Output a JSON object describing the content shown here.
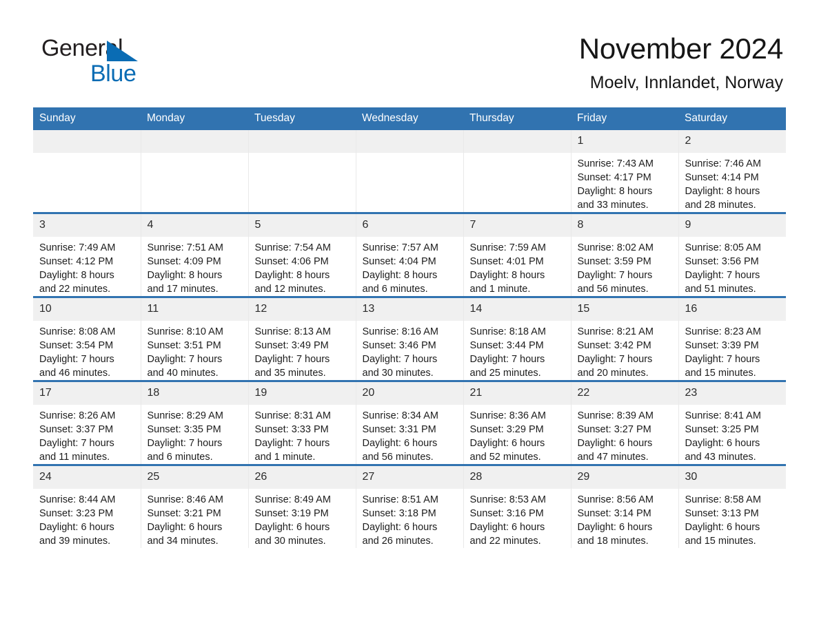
{
  "brand": {
    "name_part1": "General",
    "name_part2": "Blue",
    "triangle_color": "#0a6cb4",
    "accent_color": "#3173b0"
  },
  "header": {
    "title": "November 2024",
    "location": "Moelv, Innlandet, Norway"
  },
  "calendar": {
    "weekday_headers": [
      "Sunday",
      "Monday",
      "Tuesday",
      "Wednesday",
      "Thursday",
      "Friday",
      "Saturday"
    ],
    "weeks": [
      [
        {
          "date": "",
          "sunrise": "",
          "sunset": "",
          "daylight1": "",
          "daylight2": ""
        },
        {
          "date": "",
          "sunrise": "",
          "sunset": "",
          "daylight1": "",
          "daylight2": ""
        },
        {
          "date": "",
          "sunrise": "",
          "sunset": "",
          "daylight1": "",
          "daylight2": ""
        },
        {
          "date": "",
          "sunrise": "",
          "sunset": "",
          "daylight1": "",
          "daylight2": ""
        },
        {
          "date": "",
          "sunrise": "",
          "sunset": "",
          "daylight1": "",
          "daylight2": ""
        },
        {
          "date": "1",
          "sunrise": "Sunrise: 7:43 AM",
          "sunset": "Sunset: 4:17 PM",
          "daylight1": "Daylight: 8 hours",
          "daylight2": "and 33 minutes."
        },
        {
          "date": "2",
          "sunrise": "Sunrise: 7:46 AM",
          "sunset": "Sunset: 4:14 PM",
          "daylight1": "Daylight: 8 hours",
          "daylight2": "and 28 minutes."
        }
      ],
      [
        {
          "date": "3",
          "sunrise": "Sunrise: 7:49 AM",
          "sunset": "Sunset: 4:12 PM",
          "daylight1": "Daylight: 8 hours",
          "daylight2": "and 22 minutes."
        },
        {
          "date": "4",
          "sunrise": "Sunrise: 7:51 AM",
          "sunset": "Sunset: 4:09 PM",
          "daylight1": "Daylight: 8 hours",
          "daylight2": "and 17 minutes."
        },
        {
          "date": "5",
          "sunrise": "Sunrise: 7:54 AM",
          "sunset": "Sunset: 4:06 PM",
          "daylight1": "Daylight: 8 hours",
          "daylight2": "and 12 minutes."
        },
        {
          "date": "6",
          "sunrise": "Sunrise: 7:57 AM",
          "sunset": "Sunset: 4:04 PM",
          "daylight1": "Daylight: 8 hours",
          "daylight2": "and 6 minutes."
        },
        {
          "date": "7",
          "sunrise": "Sunrise: 7:59 AM",
          "sunset": "Sunset: 4:01 PM",
          "daylight1": "Daylight: 8 hours",
          "daylight2": "and 1 minute."
        },
        {
          "date": "8",
          "sunrise": "Sunrise: 8:02 AM",
          "sunset": "Sunset: 3:59 PM",
          "daylight1": "Daylight: 7 hours",
          "daylight2": "and 56 minutes."
        },
        {
          "date": "9",
          "sunrise": "Sunrise: 8:05 AM",
          "sunset": "Sunset: 3:56 PM",
          "daylight1": "Daylight: 7 hours",
          "daylight2": "and 51 minutes."
        }
      ],
      [
        {
          "date": "10",
          "sunrise": "Sunrise: 8:08 AM",
          "sunset": "Sunset: 3:54 PM",
          "daylight1": "Daylight: 7 hours",
          "daylight2": "and 46 minutes."
        },
        {
          "date": "11",
          "sunrise": "Sunrise: 8:10 AM",
          "sunset": "Sunset: 3:51 PM",
          "daylight1": "Daylight: 7 hours",
          "daylight2": "and 40 minutes."
        },
        {
          "date": "12",
          "sunrise": "Sunrise: 8:13 AM",
          "sunset": "Sunset: 3:49 PM",
          "daylight1": "Daylight: 7 hours",
          "daylight2": "and 35 minutes."
        },
        {
          "date": "13",
          "sunrise": "Sunrise: 8:16 AM",
          "sunset": "Sunset: 3:46 PM",
          "daylight1": "Daylight: 7 hours",
          "daylight2": "and 30 minutes."
        },
        {
          "date": "14",
          "sunrise": "Sunrise: 8:18 AM",
          "sunset": "Sunset: 3:44 PM",
          "daylight1": "Daylight: 7 hours",
          "daylight2": "and 25 minutes."
        },
        {
          "date": "15",
          "sunrise": "Sunrise: 8:21 AM",
          "sunset": "Sunset: 3:42 PM",
          "daylight1": "Daylight: 7 hours",
          "daylight2": "and 20 minutes."
        },
        {
          "date": "16",
          "sunrise": "Sunrise: 8:23 AM",
          "sunset": "Sunset: 3:39 PM",
          "daylight1": "Daylight: 7 hours",
          "daylight2": "and 15 minutes."
        }
      ],
      [
        {
          "date": "17",
          "sunrise": "Sunrise: 8:26 AM",
          "sunset": "Sunset: 3:37 PM",
          "daylight1": "Daylight: 7 hours",
          "daylight2": "and 11 minutes."
        },
        {
          "date": "18",
          "sunrise": "Sunrise: 8:29 AM",
          "sunset": "Sunset: 3:35 PM",
          "daylight1": "Daylight: 7 hours",
          "daylight2": "and 6 minutes."
        },
        {
          "date": "19",
          "sunrise": "Sunrise: 8:31 AM",
          "sunset": "Sunset: 3:33 PM",
          "daylight1": "Daylight: 7 hours",
          "daylight2": "and 1 minute."
        },
        {
          "date": "20",
          "sunrise": "Sunrise: 8:34 AM",
          "sunset": "Sunset: 3:31 PM",
          "daylight1": "Daylight: 6 hours",
          "daylight2": "and 56 minutes."
        },
        {
          "date": "21",
          "sunrise": "Sunrise: 8:36 AM",
          "sunset": "Sunset: 3:29 PM",
          "daylight1": "Daylight: 6 hours",
          "daylight2": "and 52 minutes."
        },
        {
          "date": "22",
          "sunrise": "Sunrise: 8:39 AM",
          "sunset": "Sunset: 3:27 PM",
          "daylight1": "Daylight: 6 hours",
          "daylight2": "and 47 minutes."
        },
        {
          "date": "23",
          "sunrise": "Sunrise: 8:41 AM",
          "sunset": "Sunset: 3:25 PM",
          "daylight1": "Daylight: 6 hours",
          "daylight2": "and 43 minutes."
        }
      ],
      [
        {
          "date": "24",
          "sunrise": "Sunrise: 8:44 AM",
          "sunset": "Sunset: 3:23 PM",
          "daylight1": "Daylight: 6 hours",
          "daylight2": "and 39 minutes."
        },
        {
          "date": "25",
          "sunrise": "Sunrise: 8:46 AM",
          "sunset": "Sunset: 3:21 PM",
          "daylight1": "Daylight: 6 hours",
          "daylight2": "and 34 minutes."
        },
        {
          "date": "26",
          "sunrise": "Sunrise: 8:49 AM",
          "sunset": "Sunset: 3:19 PM",
          "daylight1": "Daylight: 6 hours",
          "daylight2": "and 30 minutes."
        },
        {
          "date": "27",
          "sunrise": "Sunrise: 8:51 AM",
          "sunset": "Sunset: 3:18 PM",
          "daylight1": "Daylight: 6 hours",
          "daylight2": "and 26 minutes."
        },
        {
          "date": "28",
          "sunrise": "Sunrise: 8:53 AM",
          "sunset": "Sunset: 3:16 PM",
          "daylight1": "Daylight: 6 hours",
          "daylight2": "and 22 minutes."
        },
        {
          "date": "29",
          "sunrise": "Sunrise: 8:56 AM",
          "sunset": "Sunset: 3:14 PM",
          "daylight1": "Daylight: 6 hours",
          "daylight2": "and 18 minutes."
        },
        {
          "date": "30",
          "sunrise": "Sunrise: 8:58 AM",
          "sunset": "Sunset: 3:13 PM",
          "daylight1": "Daylight: 6 hours",
          "daylight2": "and 15 minutes."
        }
      ]
    ]
  }
}
